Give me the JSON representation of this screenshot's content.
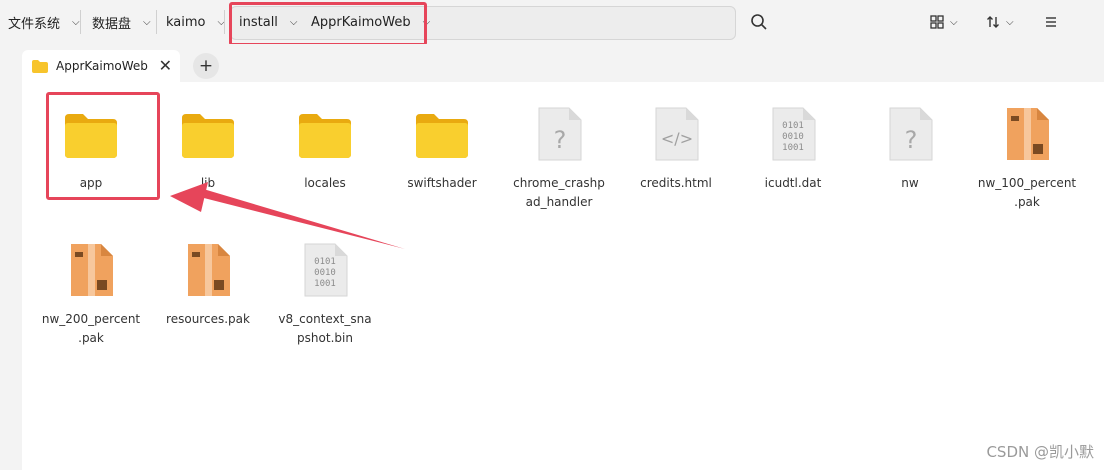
{
  "breadcrumb": [
    {
      "label": "文件系统"
    },
    {
      "label": "数据盘"
    },
    {
      "label": "kaimo"
    },
    {
      "label": "install"
    },
    {
      "label": "ApprKaimoWeb"
    }
  ],
  "toolbar": {
    "search_icon": "search-icon",
    "view_icon": "grid-view-icon",
    "sort_icon": "sort-icon",
    "menu_icon": "hamburger-menu-icon"
  },
  "tab": {
    "label": "ApprKaimoWeb"
  },
  "files": [
    {
      "name": "app",
      "type": "folder"
    },
    {
      "name": "lib",
      "type": "folder"
    },
    {
      "name": "locales",
      "type": "folder"
    },
    {
      "name": "swiftshader",
      "type": "folder"
    },
    {
      "name": "chrome_crashp\nad_handler",
      "type": "unknown"
    },
    {
      "name": "credits.html",
      "type": "html"
    },
    {
      "name": "icudtl.dat",
      "type": "binary"
    },
    {
      "name": "nw",
      "type": "unknown"
    },
    {
      "name": "nw_100_percent\n.pak",
      "type": "archive"
    },
    {
      "name": "nw_200_percent\n.pak",
      "type": "archive"
    },
    {
      "name": "resources.pak",
      "type": "archive"
    },
    {
      "name": "v8_context_sna\npshot.bin",
      "type": "binary"
    }
  ],
  "watermark": "CSDN @凯小默",
  "colors": {
    "highlight": "#e6455a",
    "folder": "#f7c42c",
    "archive": "#e89550"
  }
}
